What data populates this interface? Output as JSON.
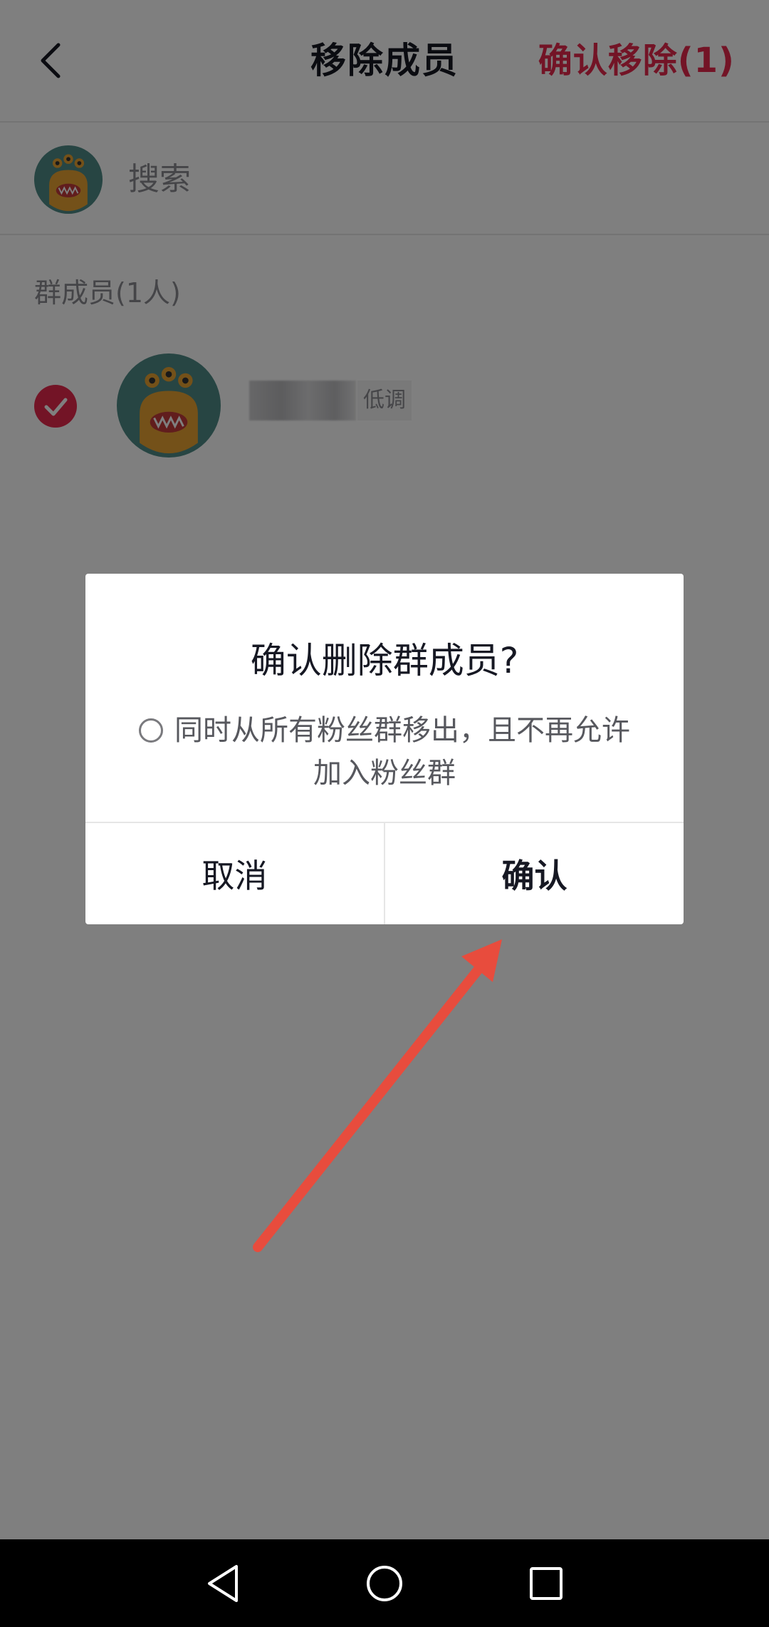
{
  "header": {
    "title": "移除成员",
    "confirm_label": "确认移除(1)"
  },
  "search": {
    "placeholder": "搜索"
  },
  "members": {
    "section_title": "群成员(1人)",
    "items": [
      {
        "name": "···",
        "tag": "低调",
        "selected": true
      }
    ]
  },
  "dialog": {
    "title": "确认删除群成员?",
    "option_label": "同时从所有粉丝群移出，且不再允许加入粉丝群",
    "option_checked": false,
    "cancel_label": "取消",
    "confirm_label": "确认"
  },
  "colors": {
    "accent": "#e6284d",
    "annotation_arrow": "#e84c3d",
    "mask": "rgba(0,0,0,0.5)"
  },
  "icons": {
    "back": "chevron-left-icon",
    "check": "check-circle-icon",
    "nav_back": "triangle-back-icon",
    "nav_home": "circle-home-icon",
    "nav_recents": "square-recents-icon"
  }
}
